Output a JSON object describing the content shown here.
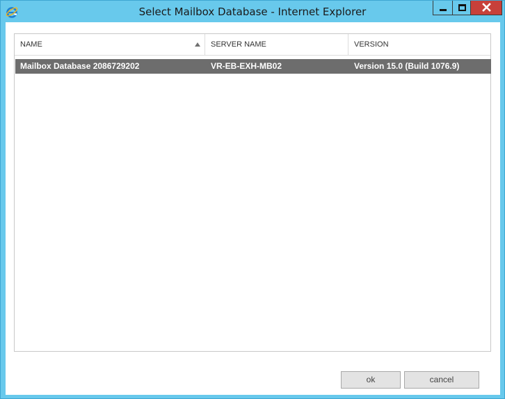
{
  "window": {
    "title": "Select Mailbox Database - Internet Explorer",
    "app_icon": "internet-explorer-icon",
    "controls": {
      "minimize": "minimize-icon",
      "maximize": "maximize-icon",
      "close": "close-icon"
    }
  },
  "grid": {
    "columns": [
      "NAME",
      "SERVER NAME",
      "VERSION"
    ],
    "sort": {
      "column": "NAME",
      "direction": "ascending",
      "icon": "sort-ascending-icon"
    },
    "rows": [
      {
        "name": "Mailbox Database 2086729202",
        "server_name": "VR-EB-EXH-MB02",
        "version": "Version 15.0 (Build 1076.9)",
        "selected": true
      }
    ]
  },
  "buttons": {
    "ok": "ok",
    "cancel": "cancel"
  },
  "colors": {
    "titlebar": "#68c9ec",
    "close_button": "#c7403a",
    "selected_row": "#6d6d6d"
  }
}
